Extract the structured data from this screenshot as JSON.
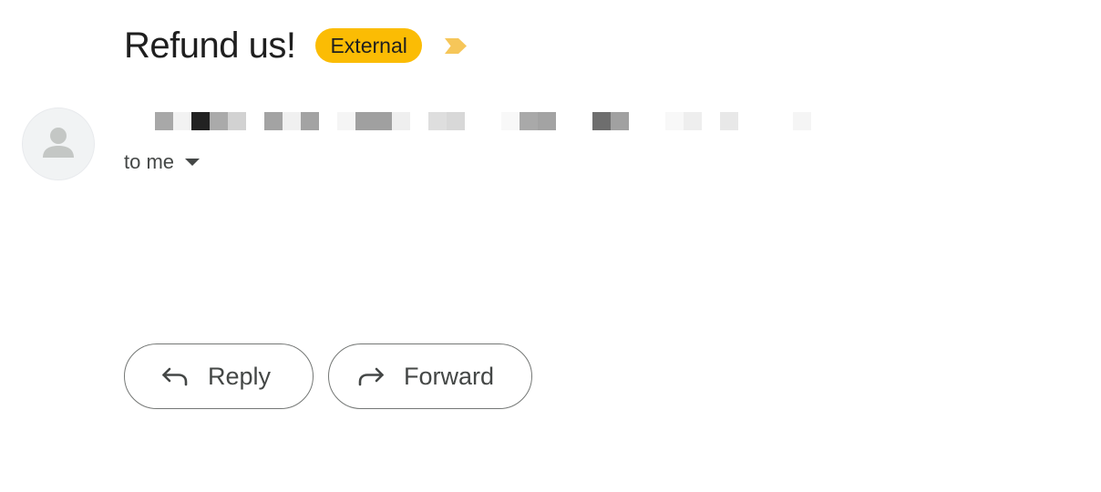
{
  "email": {
    "subject": "Refund us!",
    "label": {
      "text": "External",
      "color": "#FBBC04"
    },
    "importance_marker": {
      "icon": "importance-marker-icon",
      "color": "#F6C659"
    },
    "sender": {
      "avatar_icon": "person-icon",
      "name_redacted": true,
      "redaction_pixels": [
        "#a8a8a8",
        "#f2f2f2",
        "#222222",
        "#aaaaaa",
        "#d2d2d2",
        "#ffffff",
        "#a3a3a3",
        "#f0f0f0",
        "#a3a3a3",
        "#ffffff",
        "#f5f5f5",
        "#a0a0a0",
        "#a0a0a0",
        "#efefef",
        "#ffffff",
        "#dedede",
        "#d8d8d8",
        "#ffffff",
        "#ffffff",
        "#f8f8f8",
        "#a9a9a9",
        "#a3a3a3",
        "#ffffff",
        "#ffffff",
        "#6e6e6e",
        "#a1a1a1",
        "#ffffff",
        "#ffffff",
        "#f8f8f8",
        "#eeeeee",
        "#ffffff",
        "#e8e8e8",
        "#ffffff",
        "#ffffff",
        "#ffffff",
        "#f5f5f5"
      ]
    },
    "recipients_text": "to me",
    "recipients_icon": "caret-down-icon"
  },
  "actions": {
    "reply_label": "Reply",
    "reply_icon": "reply-arrow-icon",
    "forward_label": "Forward",
    "forward_icon": "forward-arrow-icon"
  }
}
